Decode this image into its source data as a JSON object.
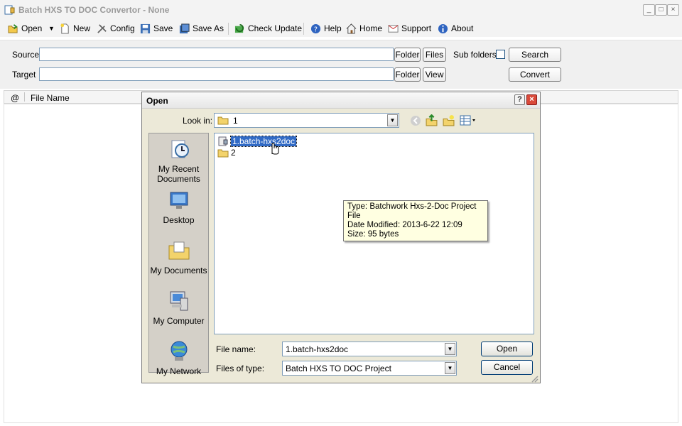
{
  "window": {
    "title": "Batch HXS TO DOC Convertor - None"
  },
  "toolbar": {
    "open": "Open",
    "new": "New",
    "config": "Config",
    "save": "Save",
    "save_as": "Save As",
    "check_update": "Check Update",
    "help": "Help",
    "home": "Home",
    "support": "Support",
    "about": "About"
  },
  "form": {
    "source_label": "Source",
    "target_label": "Target",
    "source_value": "",
    "target_value": "",
    "folder": "Folder",
    "files": "Files",
    "view": "View",
    "subfolders": "Sub folders",
    "search": "Search",
    "convert": "Convert"
  },
  "list": {
    "col_at": "@",
    "col_filename": "File Name"
  },
  "dialog": {
    "title": "Open",
    "look_in_label": "Look in:",
    "look_in_value": "1",
    "places": [
      "My Recent Documents",
      "Desktop",
      "My Documents",
      "My Computer",
      "My Network"
    ],
    "files": [
      {
        "name": "1.batch-hxs2doc",
        "selected": true
      },
      {
        "name": "2",
        "selected": false
      }
    ],
    "tooltip": {
      "type": "Type: Batchwork Hxs-2-Doc Project File",
      "modified": "Date Modified: 2013-6-22 12:09",
      "size": "Size: 95 bytes"
    },
    "file_name_label": "File name:",
    "file_name_value": "1.batch-hxs2doc",
    "file_type_label": "Files of type:",
    "file_type_value": "Batch HXS TO DOC Project",
    "open_button": "Open",
    "cancel_button": "Cancel"
  }
}
